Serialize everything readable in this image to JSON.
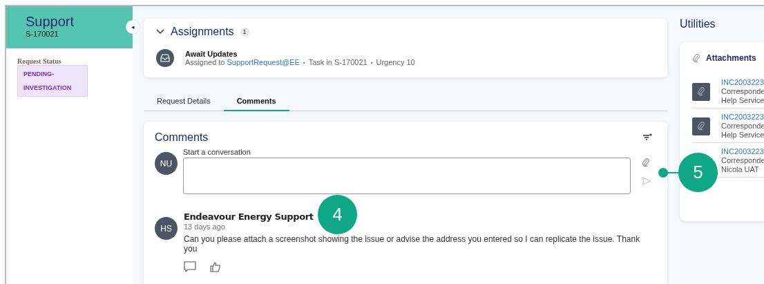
{
  "case": {
    "title": "Support",
    "id": "S-170021",
    "collapse_icon": "◂"
  },
  "request_status": {
    "label": "Request Status",
    "value": "PENDING-INVESTIGATION"
  },
  "assignments": {
    "title": "Assignments",
    "count": "1",
    "task": {
      "separator": "•",
      "title": "Await Updates",
      "prefix": "Assigned to",
      "assignee": "SupportRequest@EE",
      "task_in": "Task in S-170021",
      "urgency": "Urgency 10"
    }
  },
  "tabs": [
    {
      "label": "Request Details",
      "selected": false
    },
    {
      "label": "Comments",
      "selected": true
    }
  ],
  "comments": {
    "title": "Comments",
    "new_label": "Start a conversation",
    "user_initials": "NU",
    "items": [
      {
        "initials": "HS",
        "author": "Endeavour Energy Support",
        "time": "13 days ago",
        "text": "Can you please attach a screenshot showing the issue or advise the address you entered so I can replicate the issue. Thank you"
      }
    ]
  },
  "utilities": {
    "title": "Utilities",
    "attachments_title": "Attachments",
    "items": [
      {
        "name": "INC2003223",
        "type": "Corresponde",
        "source": "Help Service",
        "has_icon": true
      },
      {
        "name": "INC2003223",
        "type": "Corresponde",
        "source": "Help Service",
        "has_icon": true
      },
      {
        "name": "INC2003223",
        "type": "Corresponde",
        "source": "Nicola UAT",
        "has_icon": false
      }
    ]
  },
  "callouts": [
    {
      "number": "4",
      "kind": "plain"
    },
    {
      "number": "5",
      "kind": "leader"
    }
  ]
}
